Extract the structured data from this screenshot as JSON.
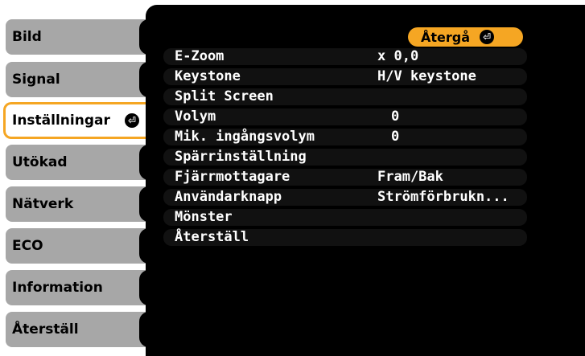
{
  "sidebar": {
    "items": [
      {
        "label": "Bild"
      },
      {
        "label": "Signal"
      },
      {
        "label": "Inställningar",
        "selected": true,
        "enter_icon": "enter-icon"
      },
      {
        "label": "Utökad"
      },
      {
        "label": "Nätverk"
      },
      {
        "label": "ECO"
      },
      {
        "label": "Information"
      },
      {
        "label": "Återställ"
      }
    ]
  },
  "panel": {
    "return_label": "Återgå",
    "return_icon": "enter-icon",
    "rows": [
      {
        "label": "E-Zoom",
        "value": "x  0,0"
      },
      {
        "label": "Keystone",
        "value": "H/V keystone"
      },
      {
        "label": "Split Screen",
        "value": ""
      },
      {
        "label": "Volym",
        "value": "0"
      },
      {
        "label": "Mik. ingångsvolym",
        "value": "0"
      },
      {
        "label": "Spärrinställning",
        "value": ""
      },
      {
        "label": "Fjärrmottagare",
        "value": "Fram/Bak"
      },
      {
        "label": "Användarknapp",
        "value": "Strömförbrukn..."
      },
      {
        "label": "Mönster",
        "value": ""
      },
      {
        "label": "Återställ",
        "value": ""
      }
    ]
  },
  "colors": {
    "accent": "#f5a623",
    "tab_bg": "#a7a7a7",
    "panel_bg": "#000000"
  }
}
